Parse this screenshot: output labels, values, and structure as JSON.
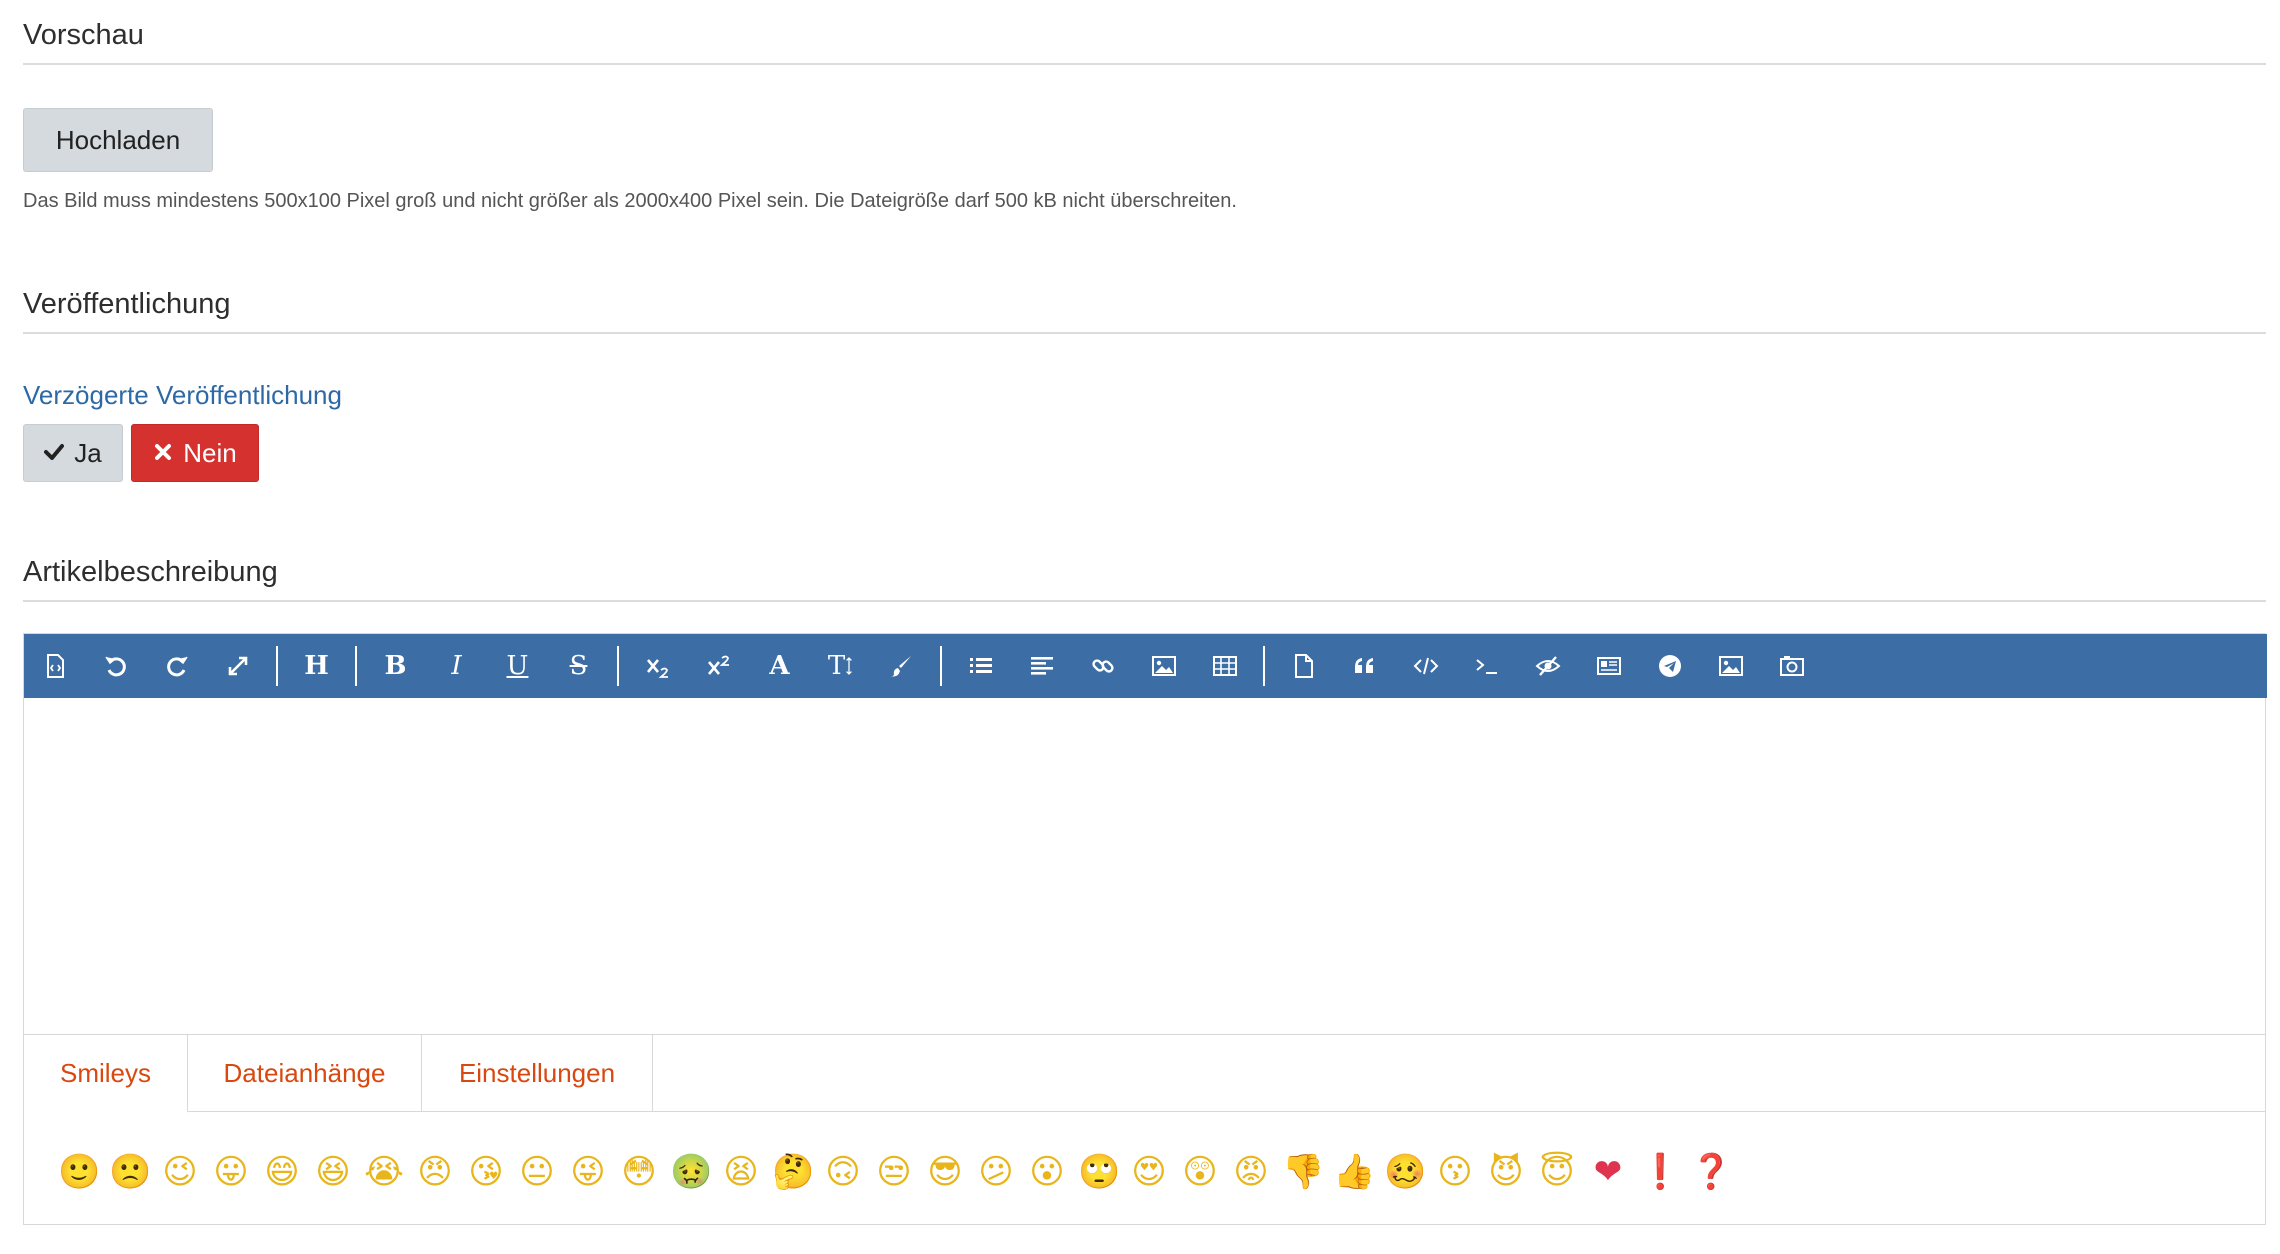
{
  "preview": {
    "heading": "Vorschau",
    "upload_label": "Hochladen",
    "hint": "Das Bild muss mindestens 500x100 Pixel groß und nicht größer als 2000x400 Pixel sein. Die Dateigröße darf 500 kB nicht überschreiten."
  },
  "publication": {
    "heading": "Veröffentlichung",
    "delayed_label": "Verzögerte Veröffentlichung",
    "yes_label": "Ja",
    "no_label": "Nein",
    "selected": "Nein"
  },
  "description": {
    "heading": "Artikelbeschreibung",
    "toolbar": {
      "background": "#3c6da4",
      "heading_glyph": "H",
      "bold_glyph": "B",
      "italic_glyph": "I",
      "underline_glyph": "U",
      "strike_glyph": "S",
      "font_glyph": "A",
      "fontsize_glyph": "T",
      "buttons": [
        "source-icon",
        "undo-icon",
        "redo-icon",
        "fullscreen-icon",
        "heading-icon",
        "bold-icon",
        "italic-icon",
        "underline-icon",
        "strikethrough-icon",
        "subscript-icon",
        "superscript-icon",
        "font-icon",
        "font-size-icon",
        "brush-icon",
        "list-icon",
        "align-icon",
        "link-icon",
        "image-icon",
        "table-icon",
        "file-icon",
        "quote-icon",
        "code-icon",
        "terminal-icon",
        "hide-icon",
        "article-icon",
        "telegram-icon",
        "gallery-icon",
        "media-icon"
      ]
    },
    "tabs": [
      {
        "label": "Smileys",
        "active": true
      },
      {
        "label": "Dateianhänge",
        "active": false
      },
      {
        "label": "Einstellungen",
        "active": false
      }
    ],
    "smileys": [
      "🙂",
      "🙁",
      "😉",
      "😛",
      "😄",
      "😆",
      "😭",
      "😠",
      "😘",
      "😐",
      "😜",
      "😳",
      "🤢",
      "😫",
      "🤔",
      "🙃",
      "😒",
      "😎",
      "😕",
      "😮",
      "🙄",
      "😍",
      "😲",
      "😡",
      "👎",
      "👍",
      "🥴",
      "😗",
      "😈",
      "😇",
      "❤",
      "❗",
      "❓"
    ]
  },
  "colors": {
    "accent": "#3c6da4",
    "danger": "#d5312e",
    "tab_text": "#d9480f",
    "label_blue": "#2d6aa5"
  }
}
